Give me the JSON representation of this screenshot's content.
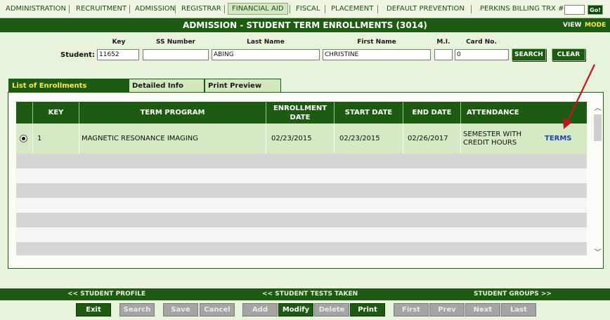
{
  "topnav": {
    "items": [
      "ADMINISTRATION",
      "RECRUITMENT",
      "ADMISSION",
      "REGISTRAR",
      "FINANCIAL AID",
      "FISCAL",
      "PLACEMENT",
      "DEFAULT PREVENTION",
      "PERKINS BILLING"
    ],
    "active": "FINANCIAL AID",
    "trx_label": "TRX #:",
    "go_label": "Go!"
  },
  "titlebar": {
    "title": "ADMISSION - STUDENT TERM ENROLLMENTS (3014)",
    "view": "VIEW",
    "mode": "MODE"
  },
  "search": {
    "student_label": "Student:",
    "labels": {
      "key": "Key",
      "ss": "SS Number",
      "last": "Last Name",
      "first": "First Name",
      "mi": "M.I.",
      "card": "Card No."
    },
    "values": {
      "key": "11652",
      "ss": "",
      "last": "ABING",
      "first": "CHRISTINE",
      "mi": "",
      "card": "0"
    },
    "search_button": "SEARCH",
    "clear_button": "CLEAR"
  },
  "tabs": [
    "List of Enrollments",
    "Detailed Info",
    "Print Preview"
  ],
  "table": {
    "headers": [
      "KEY",
      "TERM PROGRAM",
      "ENROLLMENT DATE",
      "START DATE",
      "END DATE",
      "ATTENDANCE"
    ],
    "rows": [
      {
        "key": "1",
        "program": "MAGNETIC RESONANCE IMAGING",
        "enrollment_date": "02/23/2015",
        "start_date": "02/23/2015",
        "end_date": "02/26/2017",
        "attendance": "SEMESTER WITH CREDIT HOURS",
        "link": "TERMS"
      }
    ]
  },
  "footer_links": {
    "left": "<< STUDENT PROFILE",
    "middle": "<< STUDENT TESTS TAKEN",
    "right": "STUDENT GROUPS >>"
  },
  "bottom_buttons": [
    {
      "label": "Exit",
      "enabled": true
    },
    {
      "label": "Search",
      "enabled": false
    },
    {
      "label": "Save",
      "enabled": false
    },
    {
      "label": "Cancel",
      "enabled": false
    },
    {
      "label": "Add",
      "enabled": false
    },
    {
      "label": "Modify",
      "enabled": true
    },
    {
      "label": "Delete",
      "enabled": false
    },
    {
      "label": "Print",
      "enabled": true
    },
    {
      "label": "First",
      "enabled": false
    },
    {
      "label": "Prev",
      "enabled": false
    },
    {
      "label": "Next",
      "enabled": false
    },
    {
      "label": "Last",
      "enabled": false
    }
  ],
  "colors": {
    "primary_green": "#1d5a12",
    "active_tab_text": "#ffeb3b",
    "link_blue": "#1a3fbf",
    "annotation_arrow": "#c0171b"
  }
}
